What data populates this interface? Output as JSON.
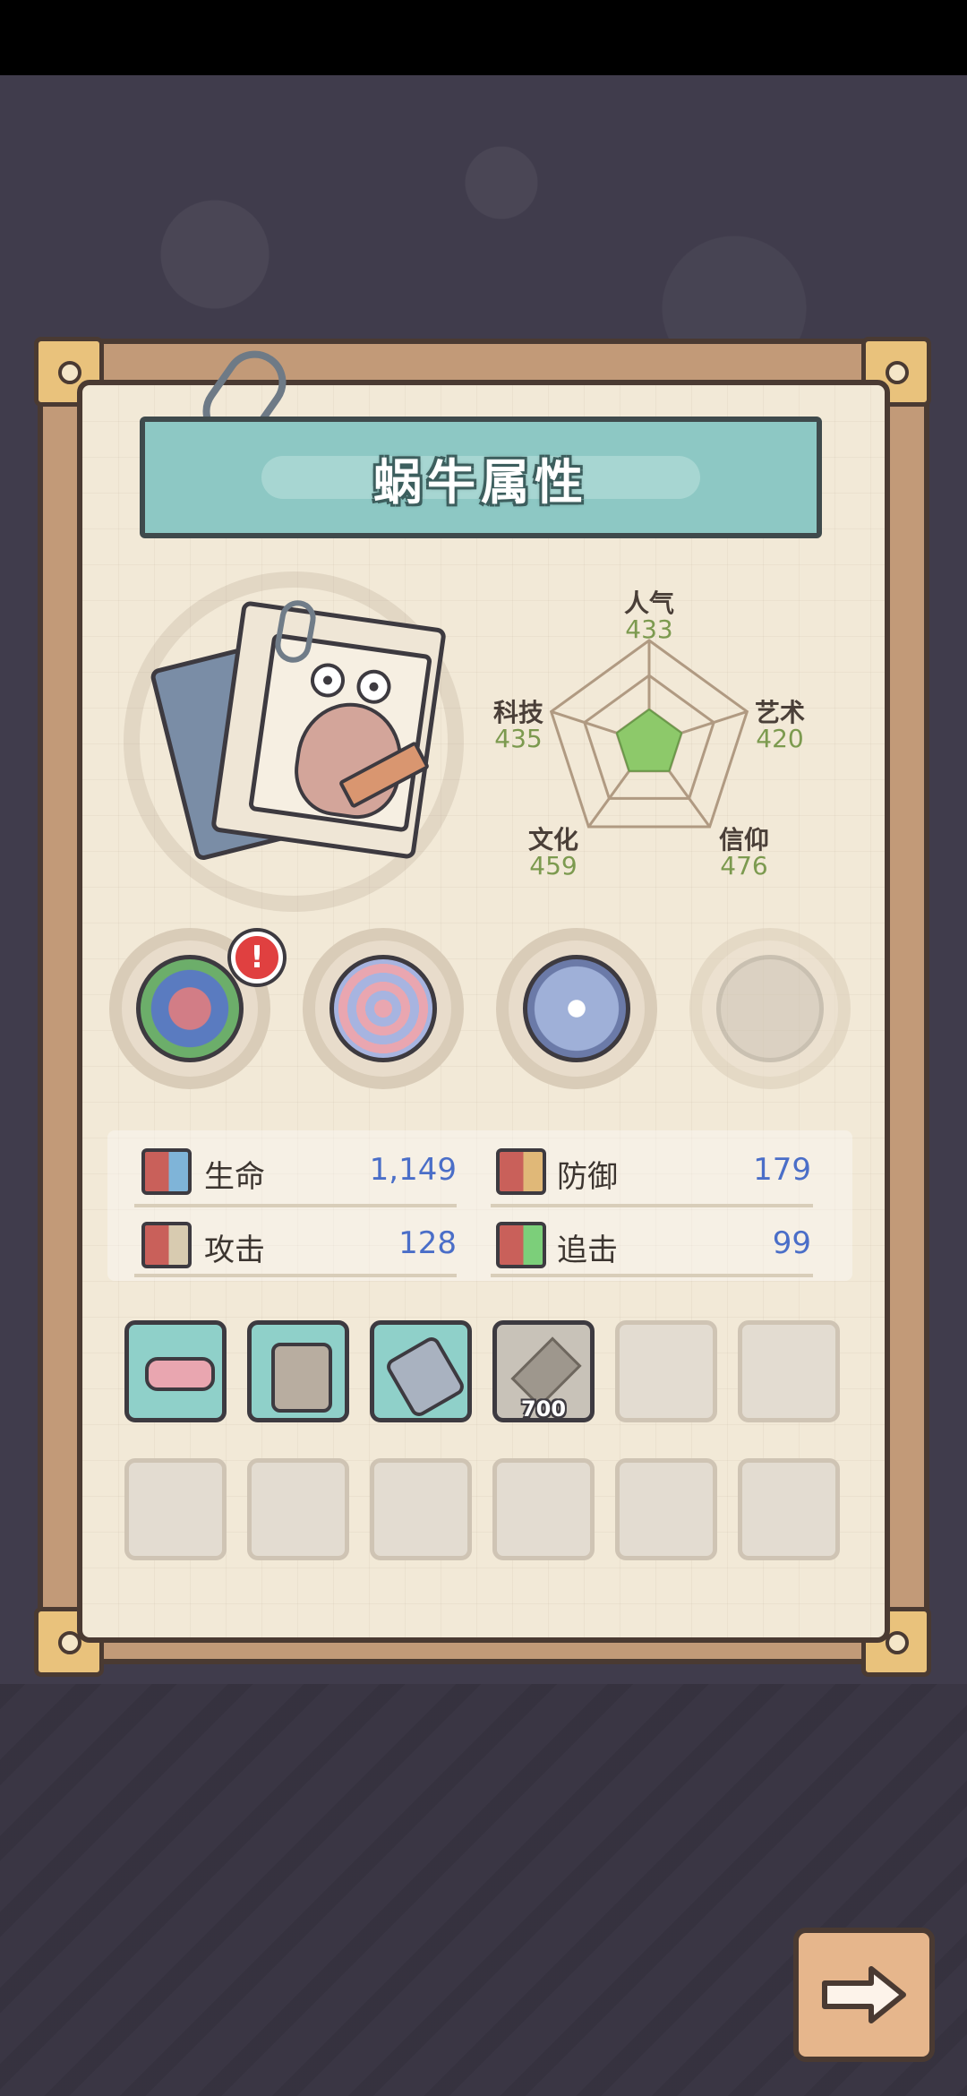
{
  "title": "蜗牛属性",
  "radar": {
    "stats": [
      {
        "label": "人气",
        "value": "433"
      },
      {
        "label": "艺术",
        "value": "420"
      },
      {
        "label": "信仰",
        "value": "476"
      },
      {
        "label": "文化",
        "value": "459"
      },
      {
        "label": "科技",
        "value": "435"
      }
    ],
    "fill_color": "#8dc96a"
  },
  "relics": [
    {
      "name": "dna-relic",
      "alert": "!"
    },
    {
      "name": "shell-relic"
    },
    {
      "name": "compass-relic"
    },
    {
      "name": "chained-relic-locked"
    }
  ],
  "stats": {
    "hp": {
      "label": "生命",
      "value": "1,149"
    },
    "defense": {
      "label": "防御",
      "value": "179"
    },
    "attack": {
      "label": "攻击",
      "value": "128"
    },
    "pursuit": {
      "label": "追击",
      "value": "99"
    }
  },
  "slots": {
    "locked_cost": "700"
  },
  "icons": {
    "next": "arrow-right-icon"
  }
}
